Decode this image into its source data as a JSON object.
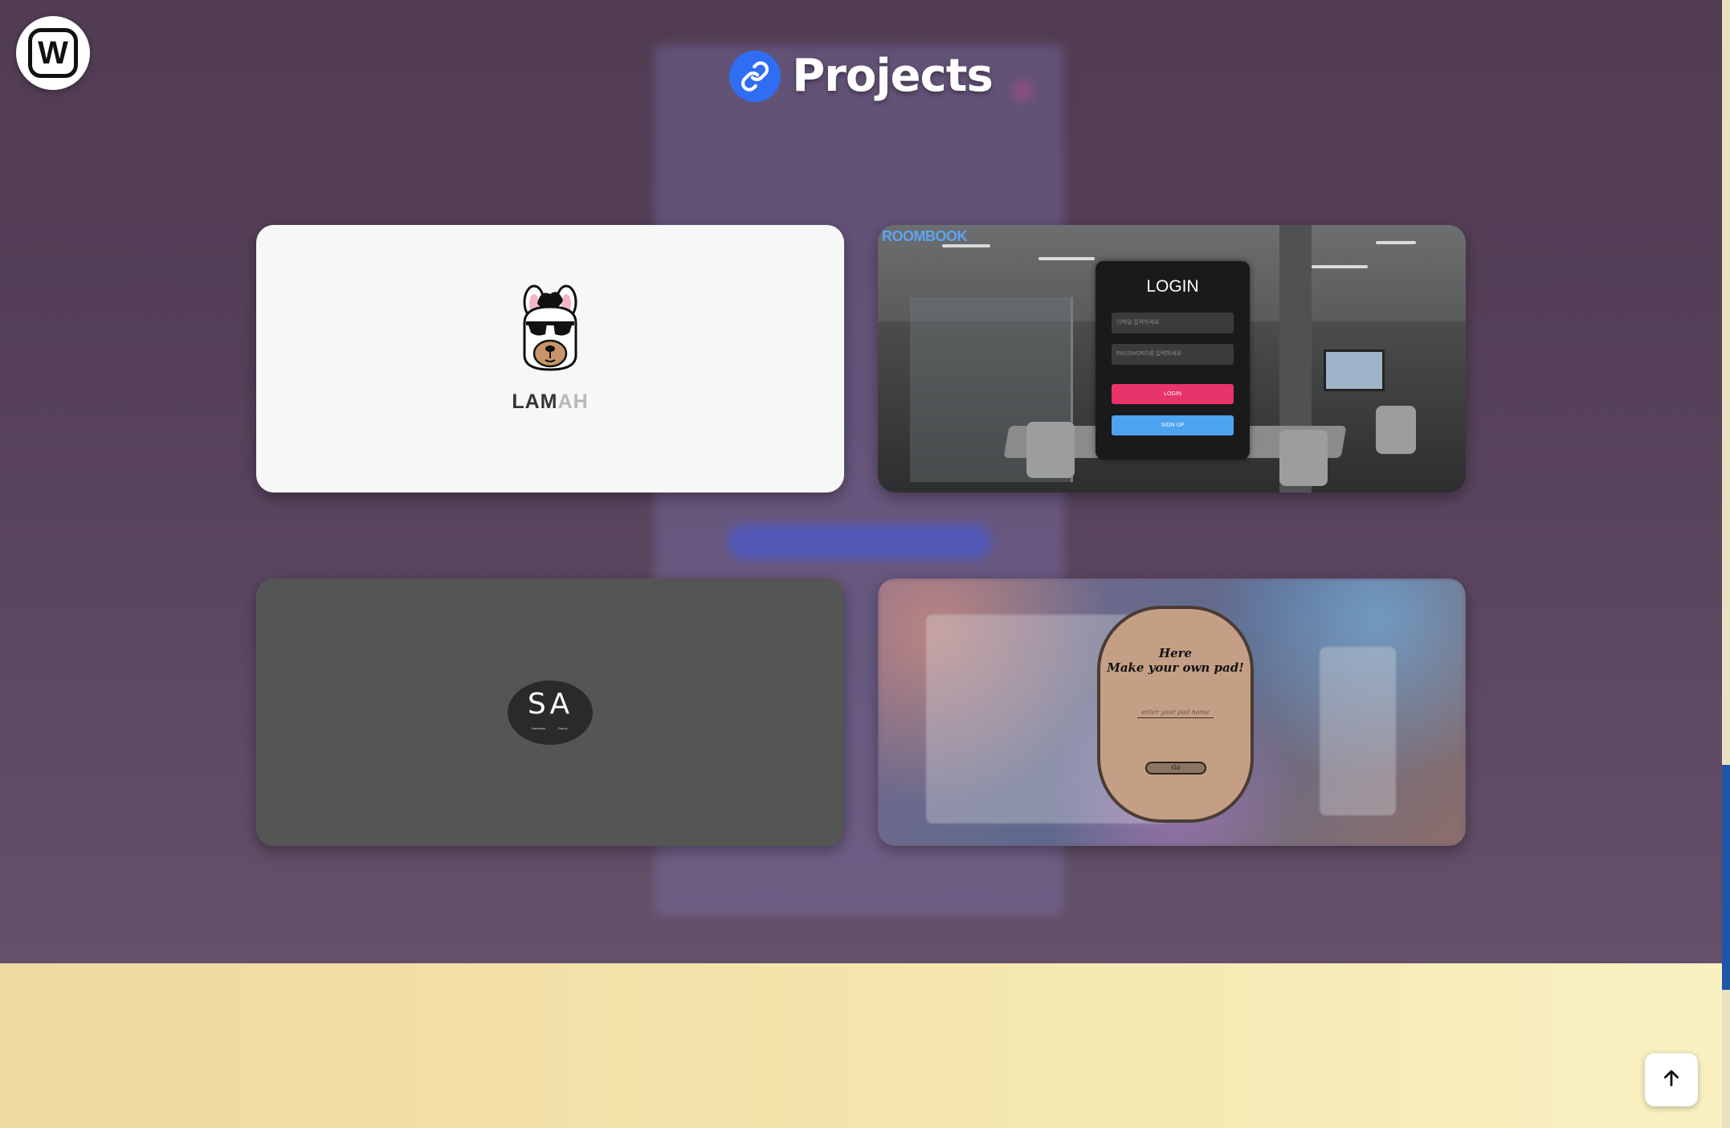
{
  "brand": {
    "logo_letter": "W"
  },
  "section": {
    "title": "Projects",
    "icon": "link-icon",
    "icon_color": "#2f6df2"
  },
  "projects": [
    {
      "id": "lamah",
      "logo_icon": "llama-sunglasses-icon",
      "wordmark_dark": "LAM",
      "wordmark_light": "AH",
      "background": "#f7f7f7"
    },
    {
      "id": "roombook",
      "brand": "ROOMBOOK",
      "login_title": "LOGIN",
      "email_placeholder": "이메일 입력하세요",
      "password_placeholder": "PASSWORD를 입력하세요",
      "login_button": "LOGIN",
      "signup_button": "SIGN UP",
      "login_button_color": "#e8336b",
      "signup_button_color": "#4ea3f0"
    },
    {
      "id": "sa",
      "badge_letters": "SA",
      "badge_left_caption": "Nameider",
      "badge_right_caption": "Ranny",
      "background": "#555555"
    },
    {
      "id": "pad",
      "title_line1": "Here",
      "title_line2": "Make your own pad!",
      "input_placeholder": "enter your pad name",
      "go_button": "Go"
    }
  ],
  "controls": {
    "scroll_top_icon": "arrow-up-icon"
  },
  "colors": {
    "purple_bg": "#56405a",
    "cream_bg": "#f4e6ad"
  }
}
